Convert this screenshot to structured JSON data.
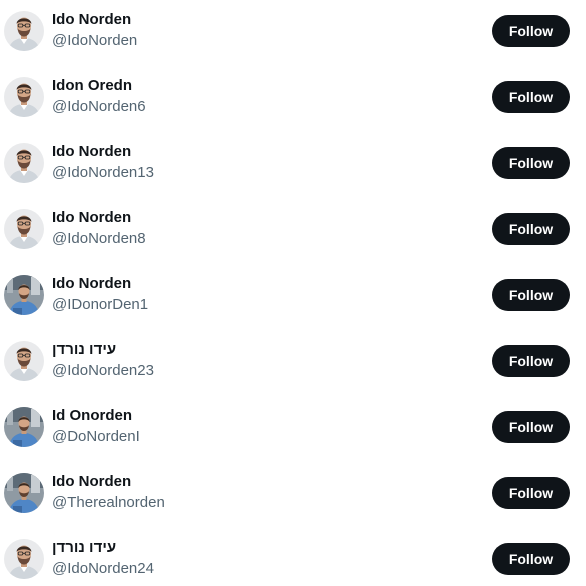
{
  "accounts": [
    {
      "name": "Ido Norden",
      "handle": "@IdoNorden",
      "avatar": "headshot-avatar-icon",
      "button": "Follow"
    },
    {
      "name": "Idon Oredn",
      "handle": "@IdoNorden6",
      "avatar": "headshot-avatar-icon",
      "button": "Follow"
    },
    {
      "name": "Ido Norden",
      "handle": "@IdoNorden13",
      "avatar": "headshot-avatar-icon",
      "button": "Follow"
    },
    {
      "name": "Ido Norden",
      "handle": "@IdoNorden8",
      "avatar": "headshot-avatar-icon",
      "button": "Follow"
    },
    {
      "name": "Ido Norden",
      "handle": "@IDonorDen1",
      "avatar": "blue-shirt-avatar-icon",
      "button": "Follow"
    },
    {
      "name": "עידו נורדן",
      "handle": "@IdoNorden23",
      "avatar": "headshot-avatar-icon",
      "button": "Follow"
    },
    {
      "name": "Id Onorden",
      "handle": "@DoNordenI",
      "avatar": "blue-shirt-avatar-icon",
      "button": "Follow"
    },
    {
      "name": "Ido Norden",
      "handle": "@Therealnorden",
      "avatar": "blue-shirt-avatar-icon",
      "button": "Follow"
    },
    {
      "name": "עידו נורדן",
      "handle": "@IdoNorden24",
      "avatar": "headshot-avatar-icon",
      "button": "Follow"
    }
  ],
  "colors": {
    "name_text": "#0f1419",
    "handle_text": "#536471",
    "follow_button_bg": "#0f1419",
    "follow_button_text": "#ffffff"
  }
}
